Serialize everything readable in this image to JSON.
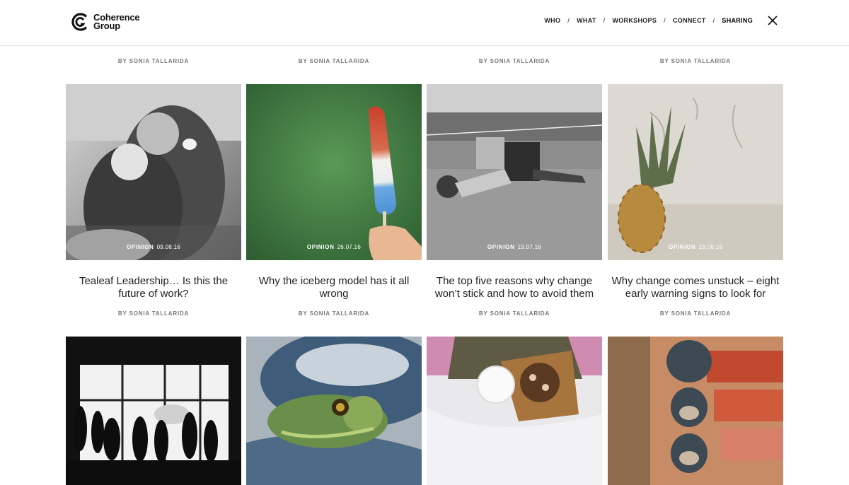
{
  "brand": {
    "name_line1": "Coherence",
    "name_line2": "Group"
  },
  "nav": [
    {
      "label": "WHO"
    },
    {
      "label": "WHAT"
    },
    {
      "label": "WORKSHOPS"
    },
    {
      "label": "CONNECT"
    },
    {
      "label": "SHARING",
      "active": true
    }
  ],
  "nav_separator": "/",
  "author_prefix": "BY",
  "top_row": [
    {
      "author": "SONIA TALLARIDA"
    },
    {
      "author": "SONIA TALLARIDA"
    },
    {
      "author": "SONIA TALLARIDA"
    },
    {
      "author": "SONIA TALLARIDA"
    }
  ],
  "posts": [
    {
      "category": "OPINION",
      "date": "09.08.16",
      "title": "Tealeaf Leadership… Is this the future of work?",
      "author": "SONIA TALLARIDA",
      "image": "engraving-two-women-teacup"
    },
    {
      "category": "OPINION",
      "date": "26.07.16",
      "title": "Why the iceberg model has it all wrong",
      "author": "SONIA TALLARIDA",
      "image": "ice-pop-held-in-hand"
    },
    {
      "category": "OPINION",
      "date": "19.07.16",
      "title": "The top five reasons why change won’t stick and how to avoid them",
      "author": "SONIA TALLARIDA",
      "image": "child-pegged-to-clothesline"
    },
    {
      "category": "OPINION",
      "date": "23.06.16",
      "title": "Why change comes unstuck – eight early warning signs to look for",
      "author": "SONIA TALLARIDA",
      "image": "pineapple-against-wall"
    }
  ],
  "bottom_row": [
    {
      "image": "people-silhouettes-window"
    },
    {
      "image": "frog-on-pot"
    },
    {
      "image": "coffee-and-pastry"
    },
    {
      "image": "three-wise-monkeys"
    }
  ],
  "colors": {
    "background": "#ffffff",
    "text": "#222222",
    "muted": "#777777",
    "divider": "#e6e6e6"
  }
}
